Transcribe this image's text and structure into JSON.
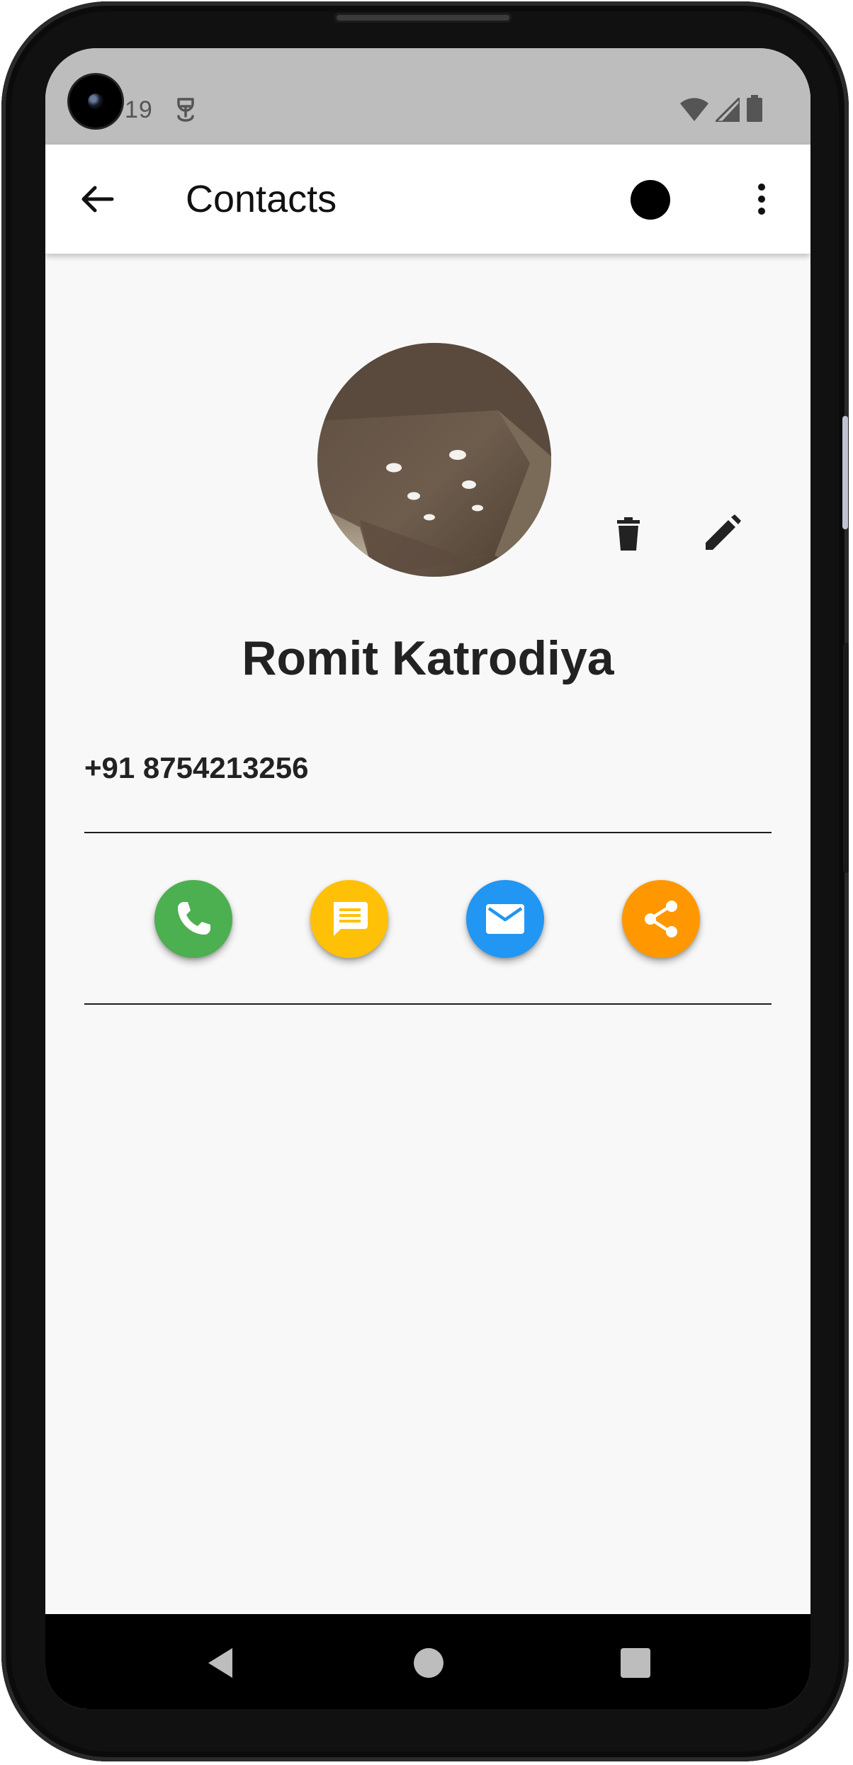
{
  "status_bar": {
    "time": "19",
    "icons": [
      "app-notification-icon",
      "wifi-icon",
      "cell-signal-icon",
      "battery-icon"
    ]
  },
  "app_bar": {
    "title": "Contacts",
    "back_icon": "arrow-back-icon",
    "profile_icon": "circle-icon",
    "menu_icon": "more-vert-icon"
  },
  "contact": {
    "name": "Romit Katrodiya",
    "phone": "+91 8754213256",
    "avatar": "contact-photo"
  },
  "actions": [
    {
      "name": "call",
      "icon": "phone-icon",
      "color": "#4caf50"
    },
    {
      "name": "sms",
      "icon": "message-icon",
      "color": "#ffc107"
    },
    {
      "name": "email",
      "icon": "email-icon",
      "color": "#2196f3"
    },
    {
      "name": "share",
      "icon": "share-icon",
      "color": "#ff9800"
    }
  ],
  "colors": {
    "status_bar": "#bdbdbd",
    "app_bar": "#ffffff",
    "background": "#f8f8f8",
    "text": "#222222"
  },
  "nav_bar": {
    "icons": [
      "nav-back-icon",
      "nav-home-icon",
      "nav-recents-icon"
    ]
  }
}
